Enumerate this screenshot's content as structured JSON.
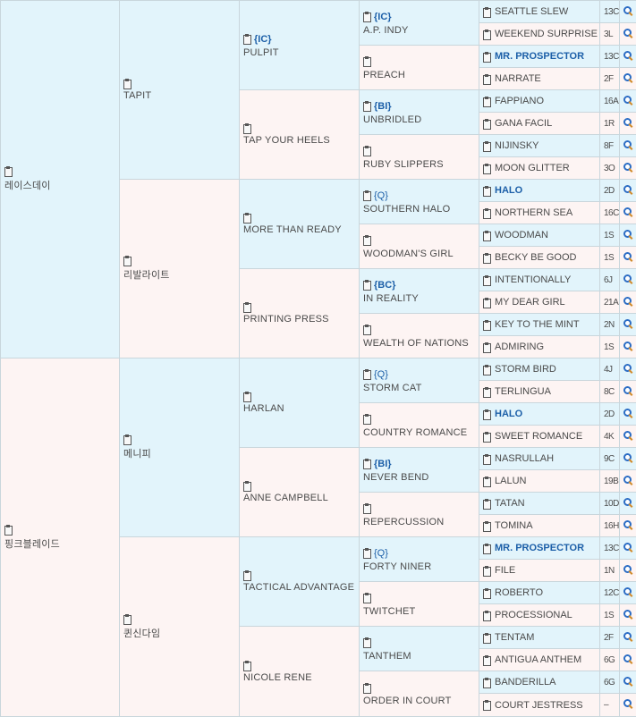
{
  "gen1": [
    "레이스데이",
    "핑크블레이드"
  ],
  "gen2": [
    "TAPIT",
    "리발라이트",
    "메니피",
    "퀸신다임"
  ],
  "gen3": [
    "PULPIT",
    "TAP YOUR HEELS",
    "MORE THAN READY",
    "PRINTING PRESS",
    "HARLAN",
    "ANNE CAMPBELL",
    "TACTICAL ADVANTAGE",
    "NICOLE RENE"
  ],
  "gen4": [
    {
      "tag": "{IC}",
      "name": "A.P. INDY"
    },
    {
      "tag": "",
      "name": "PREACH"
    },
    {
      "tag": "{BI}",
      "name": "UNBRIDLED"
    },
    {
      "tag": "",
      "name": "RUBY SLIPPERS"
    },
    {
      "tag": "{Q}",
      "name": "SOUTHERN HALO"
    },
    {
      "tag": "",
      "name": "WOODMAN'S GIRL"
    },
    {
      "tag": "{BC}",
      "name": "IN REALITY"
    },
    {
      "tag": "",
      "name": "WEALTH OF NATIONS"
    },
    {
      "tag": "{Q}",
      "name": "STORM CAT"
    },
    {
      "tag": "",
      "name": "COUNTRY ROMANCE"
    },
    {
      "tag": "{BI}",
      "name": "NEVER BEND"
    },
    {
      "tag": "",
      "name": "REPERCUSSION"
    },
    {
      "tag": "{Q}",
      "name": "FORTY NINER"
    },
    {
      "tag": "",
      "name": "TWITCHET"
    },
    {
      "tag": "",
      "name": "TANTHEM"
    },
    {
      "tag": "",
      "name": "ORDER IN COURT"
    }
  ],
  "pulpit_tag": "{IC}",
  "gen5": [
    {
      "name": "SEATTLE SLEW",
      "code": "13C",
      "hl": false
    },
    {
      "name": "WEEKEND SURPRISE",
      "code": "3L",
      "hl": false
    },
    {
      "name": "MR. PROSPECTOR",
      "code": "13C",
      "hl": true
    },
    {
      "name": "NARRATE",
      "code": "2F",
      "hl": false
    },
    {
      "name": "FAPPIANO",
      "code": "16A",
      "hl": false
    },
    {
      "name": "GANA FACIL",
      "code": "1R",
      "hl": false
    },
    {
      "name": "NIJINSKY",
      "code": "8F",
      "hl": false
    },
    {
      "name": "MOON GLITTER",
      "code": "3O",
      "hl": false
    },
    {
      "name": "HALO",
      "code": "2D",
      "hl": true
    },
    {
      "name": "NORTHERN SEA",
      "code": "16C",
      "hl": false
    },
    {
      "name": "WOODMAN",
      "code": "1S",
      "hl": false
    },
    {
      "name": "BECKY BE GOOD",
      "code": "1S",
      "hl": false
    },
    {
      "name": "INTENTIONALLY",
      "code": "6J",
      "hl": false
    },
    {
      "name": "MY DEAR GIRL",
      "code": "21A",
      "hl": false
    },
    {
      "name": "KEY TO THE MINT",
      "code": "2N",
      "hl": false
    },
    {
      "name": "ADMIRING",
      "code": "1S",
      "hl": false
    },
    {
      "name": "STORM BIRD",
      "code": "4J",
      "hl": false
    },
    {
      "name": "TERLINGUA",
      "code": "8C",
      "hl": false
    },
    {
      "name": "HALO",
      "code": "2D",
      "hl": true
    },
    {
      "name": "SWEET ROMANCE",
      "code": "4K",
      "hl": false
    },
    {
      "name": "NASRULLAH",
      "code": "9C",
      "hl": false
    },
    {
      "name": "LALUN",
      "code": "19B",
      "hl": false
    },
    {
      "name": "TATAN",
      "code": "10D",
      "hl": false
    },
    {
      "name": "TOMINA",
      "code": "16H",
      "hl": false
    },
    {
      "name": "MR. PROSPECTOR",
      "code": "13C",
      "hl": true
    },
    {
      "name": "FILE",
      "code": "1N",
      "hl": false
    },
    {
      "name": "ROBERTO",
      "code": "12C",
      "hl": false
    },
    {
      "name": "PROCESSIONAL",
      "code": "1S",
      "hl": false
    },
    {
      "name": "TENTAM",
      "code": "2F",
      "hl": false
    },
    {
      "name": "ANTIGUA ANTHEM",
      "code": "6G",
      "hl": false
    },
    {
      "name": "BANDERILLA",
      "code": "6G",
      "hl": false
    },
    {
      "name": "COURT JESTRESS",
      "code": "–",
      "hl": false
    }
  ],
  "colors": {
    "sire_bg": "#e2f4fb",
    "dam_bg": "#fdf4f3",
    "tag": "#1c5fa8",
    "border": "#c9d6dc"
  },
  "icons": {
    "clipboard": "clipboard-icon",
    "search": "search-icon"
  }
}
